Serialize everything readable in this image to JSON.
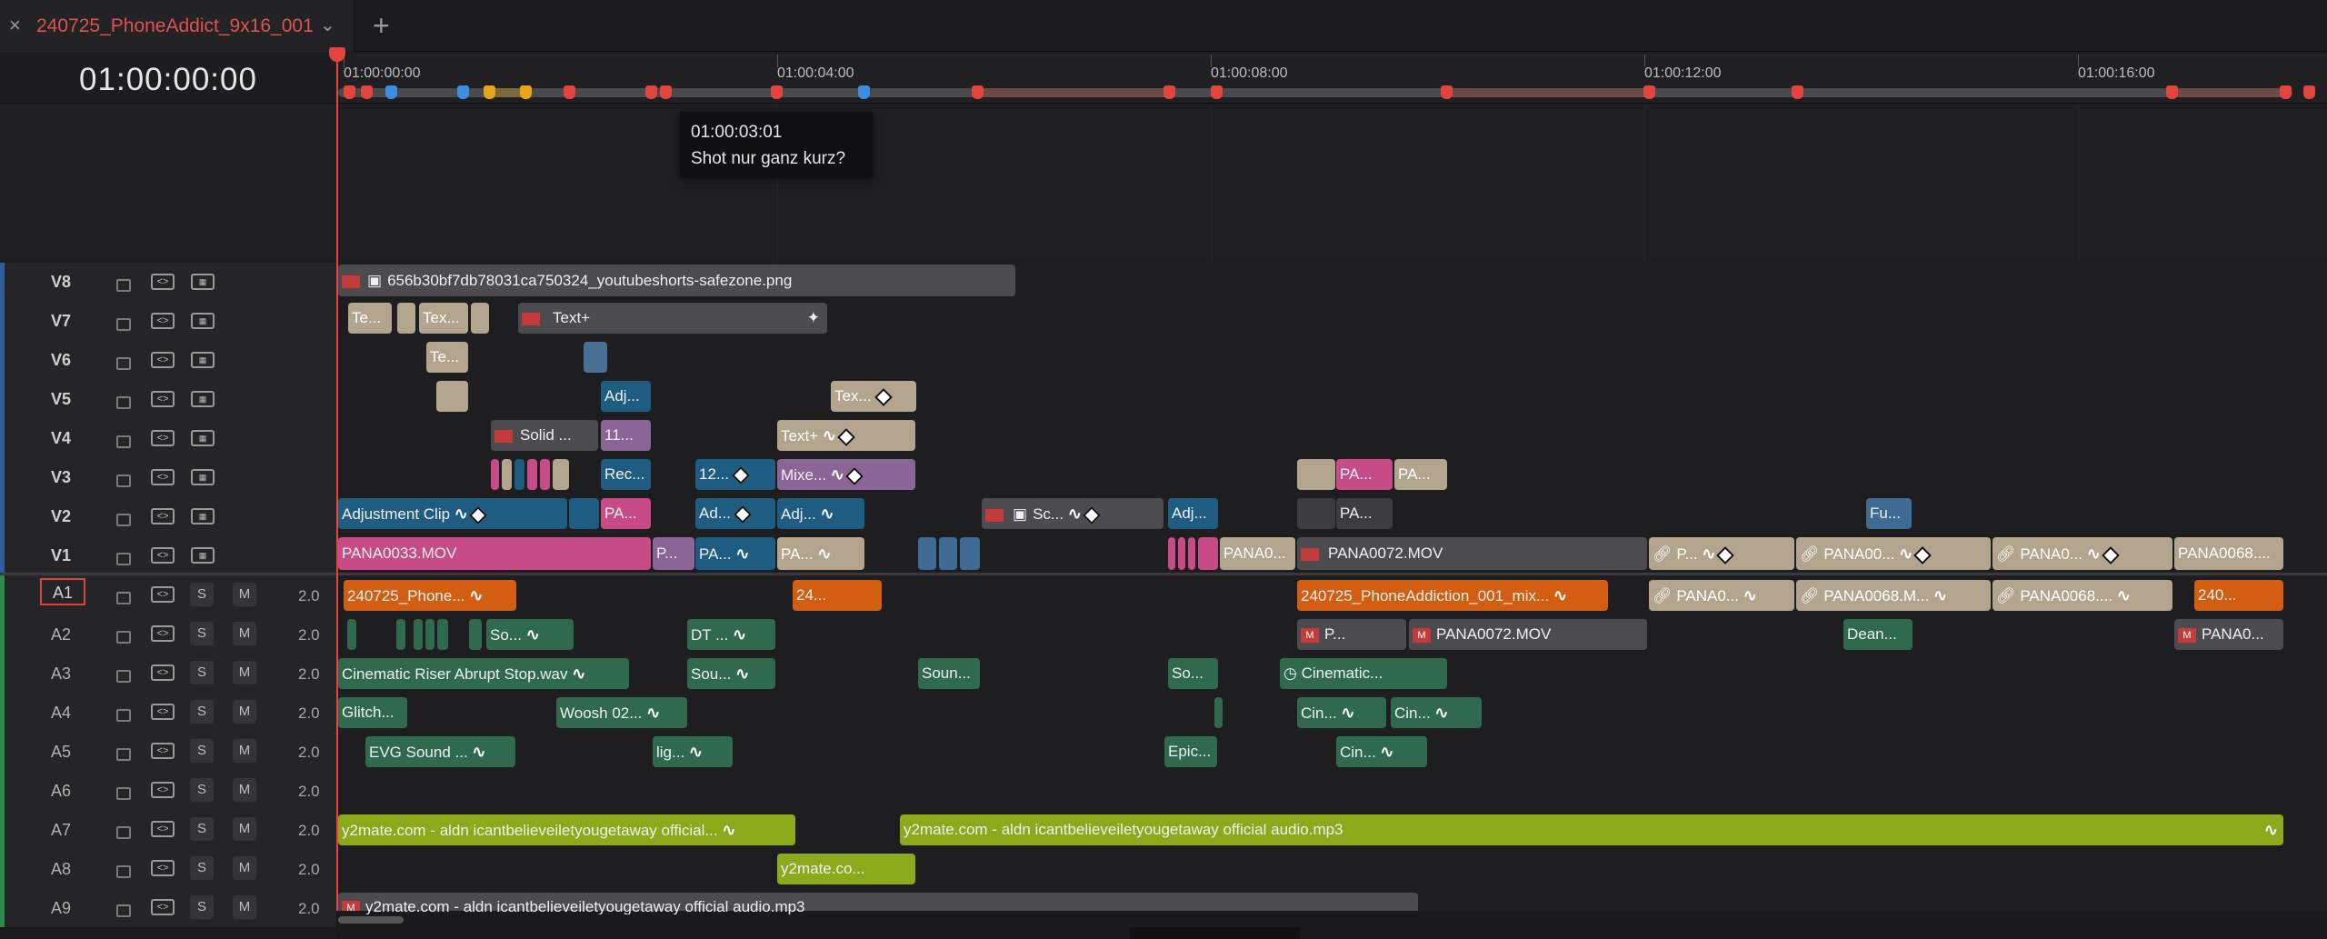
{
  "tab": {
    "close_icon": "×",
    "title": "240725_PhoneAddict_9x16_001",
    "dropdown_icon": "⌄",
    "add_icon": "+"
  },
  "timecode": "01:00:00:00",
  "ruler": {
    "labels": [
      "01:00:00:00",
      "01:00:04:00",
      "01:00:08:00",
      "01:00:12:00",
      "01:00:16:00"
    ]
  },
  "tooltip": {
    "time": "01:00:03:01",
    "text": "Shot nur ganz kurz?"
  },
  "video_tracks": [
    {
      "id": "V8"
    },
    {
      "id": "V7"
    },
    {
      "id": "V6"
    },
    {
      "id": "V5"
    },
    {
      "id": "V4"
    },
    {
      "id": "V3"
    },
    {
      "id": "V2"
    },
    {
      "id": "V1"
    }
  ],
  "audio_tracks": [
    {
      "id": "A1",
      "vol": "2.0"
    },
    {
      "id": "A2",
      "vol": "2.0"
    },
    {
      "id": "A3",
      "vol": "2.0"
    },
    {
      "id": "A4",
      "vol": "2.0"
    },
    {
      "id": "A5",
      "vol": "2.0"
    },
    {
      "id": "A6",
      "vol": "2.0"
    },
    {
      "id": "A7",
      "vol": "2.0"
    },
    {
      "id": "A8",
      "vol": "2.0"
    },
    {
      "id": "A9",
      "vol": "2.0"
    }
  ],
  "buttons": {
    "solo": "S",
    "mute": "M"
  },
  "clips": {
    "v8_png": "656b30bf7db78031ca750324_youtubeshorts-safezone.png",
    "v7_te": "Te...",
    "v7_tex": "Tex...",
    "v7_textplus": "Text+",
    "v6_te": "Te...",
    "v5_adj": "Adj...",
    "v5_tex": "Tex...",
    "v4_solid": "Solid ...",
    "v4_11": "11...",
    "v4_textplus": "Text+",
    "v3_rec": "Rec...",
    "v3_12": "12...",
    "v3_mixe": "Mixe...",
    "v3_pa1": "PA...",
    "v3_pa2": "PA...",
    "v2_adjclip": "Adjustment Clip",
    "v2_pa": "PA...",
    "v2_ad": "Ad...",
    "v2_adj": "Adj...",
    "v2_sc": "Sc...",
    "v2_adj2": "Adj...",
    "v2_pa3": "PA...",
    "v2_fu": "Fu...",
    "v1_pana33": "PANA0033.MOV",
    "v1_p": "P...",
    "v1_pa": "PA...",
    "v1_pa2": "PA...",
    "v1_pana0": "PANA0...",
    "v1_pana72": "PANA0072.MOV",
    "v1_p3": "P...",
    "v1_pana00": "PANA00...",
    "v1_pana0b": "PANA0...",
    "v1_pana68": "PANA0068....",
    "a1_phone": "240725_Phone...",
    "a1_24": "24...",
    "a1_mix": "240725_PhoneAddiction_001_mix...",
    "a1_pana0": "PANA0...",
    "a1_pana68m": "PANA0068.M...",
    "a1_pana68": "PANA0068....",
    "a1_240": "240...",
    "a2_so": "So...",
    "a2_dt": "DT ...",
    "a2_p": "P...",
    "a2_pana72": "PANA0072.MOV",
    "a2_dean": "Dean...",
    "a2_pana0": "PANA0...",
    "a3_riser": "Cinematic Riser Abrupt Stop.wav",
    "a3_sou": "Sou...",
    "a3_soun": "Soun...",
    "a3_so": "So...",
    "a3_cine": "Cinematic...",
    "a4_glitch": "Glitch...",
    "a4_woosh": "Woosh 02...",
    "a4_cin1": "Cin...",
    "a4_cin2": "Cin...",
    "a5_evg": "EVG Sound ...",
    "a5_lig": "lig...",
    "a5_epic": "Epic...",
    "a5_cin": "Cin...",
    "a7_y2a": "y2mate.com - aldn  icantbelieveiletyougetaway official...",
    "a7_y2b": "y2mate.com - aldn  icantbelieveiletyougetaway official audio.mp3",
    "a8_y2": "y2mate.co...",
    "a9_y2": "y2mate.com - aldn  icantbelieveiletyougetaway official audio.mp3"
  },
  "icons": {
    "lock": "lock-icon",
    "autoselect": "auto-select-icon",
    "film": "film-icon",
    "image": "image-icon",
    "link": "link-icon",
    "fade": "fade-curve-icon",
    "keyframe": "keyframe-icon",
    "speed": "speed-icon",
    "magic": "effects-icon"
  },
  "colors": {
    "playhead": "#e3443c",
    "accent_red": "#e0524d",
    "video_stripe": "#2f5f9a",
    "audio_stripe": "#2f8a4e"
  }
}
